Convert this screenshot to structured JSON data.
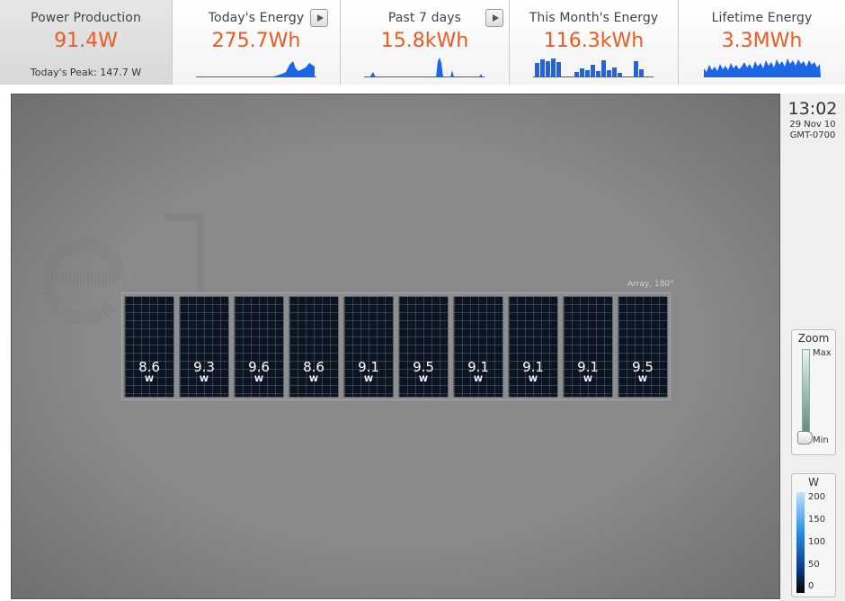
{
  "tiles": {
    "power": {
      "label": "Power Production",
      "value": "91.4W",
      "sub": "Today's Peak: 147.7 W"
    },
    "today": {
      "label": "Today's Energy",
      "value": "275.7Wh"
    },
    "week": {
      "label": "Past 7 days",
      "value": "15.8kWh"
    },
    "month": {
      "label": "This Month's Energy",
      "value": "116.3kWh"
    },
    "life": {
      "label": "Lifetime Energy",
      "value": "3.3MWh"
    }
  },
  "array": {
    "label": "Array, 180°",
    "unit": "W",
    "panels": [
      {
        "value": "8.6"
      },
      {
        "value": "9.3"
      },
      {
        "value": "9.6"
      },
      {
        "value": "8.6"
      },
      {
        "value": "9.1"
      },
      {
        "value": "9.5"
      },
      {
        "value": "9.1"
      },
      {
        "value": "9.1"
      },
      {
        "value": "9.1"
      },
      {
        "value": "9.5"
      }
    ]
  },
  "clock": {
    "time": "13:02",
    "date": "29 Nov 10",
    "tz": "GMT-0700"
  },
  "zoom": {
    "title": "Zoom",
    "max": "Max",
    "min": "Min",
    "level": 0
  },
  "legend": {
    "title": "W",
    "ticks": [
      "200",
      "150",
      "100",
      "50",
      "0"
    ]
  },
  "colors": {
    "accent": "#ef5a1e",
    "spark": "#1a66e6",
    "panel": "#0b1420"
  }
}
